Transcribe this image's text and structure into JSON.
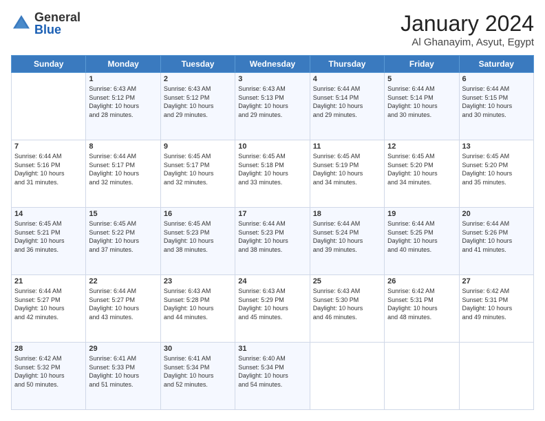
{
  "header": {
    "logo": {
      "general": "General",
      "blue": "Blue"
    },
    "title": "January 2024",
    "subtitle": "Al Ghanayim, Asyut, Egypt"
  },
  "weekdays": [
    "Sunday",
    "Monday",
    "Tuesday",
    "Wednesday",
    "Thursday",
    "Friday",
    "Saturday"
  ],
  "weeks": [
    [
      {
        "day": "",
        "info": ""
      },
      {
        "day": "1",
        "info": "Sunrise: 6:43 AM\nSunset: 5:12 PM\nDaylight: 10 hours\nand 28 minutes."
      },
      {
        "day": "2",
        "info": "Sunrise: 6:43 AM\nSunset: 5:12 PM\nDaylight: 10 hours\nand 29 minutes."
      },
      {
        "day": "3",
        "info": "Sunrise: 6:43 AM\nSunset: 5:13 PM\nDaylight: 10 hours\nand 29 minutes."
      },
      {
        "day": "4",
        "info": "Sunrise: 6:44 AM\nSunset: 5:14 PM\nDaylight: 10 hours\nand 29 minutes."
      },
      {
        "day": "5",
        "info": "Sunrise: 6:44 AM\nSunset: 5:14 PM\nDaylight: 10 hours\nand 30 minutes."
      },
      {
        "day": "6",
        "info": "Sunrise: 6:44 AM\nSunset: 5:15 PM\nDaylight: 10 hours\nand 30 minutes."
      }
    ],
    [
      {
        "day": "7",
        "info": "Sunrise: 6:44 AM\nSunset: 5:16 PM\nDaylight: 10 hours\nand 31 minutes."
      },
      {
        "day": "8",
        "info": "Sunrise: 6:44 AM\nSunset: 5:17 PM\nDaylight: 10 hours\nand 32 minutes."
      },
      {
        "day": "9",
        "info": "Sunrise: 6:45 AM\nSunset: 5:17 PM\nDaylight: 10 hours\nand 32 minutes."
      },
      {
        "day": "10",
        "info": "Sunrise: 6:45 AM\nSunset: 5:18 PM\nDaylight: 10 hours\nand 33 minutes."
      },
      {
        "day": "11",
        "info": "Sunrise: 6:45 AM\nSunset: 5:19 PM\nDaylight: 10 hours\nand 34 minutes."
      },
      {
        "day": "12",
        "info": "Sunrise: 6:45 AM\nSunset: 5:20 PM\nDaylight: 10 hours\nand 34 minutes."
      },
      {
        "day": "13",
        "info": "Sunrise: 6:45 AM\nSunset: 5:20 PM\nDaylight: 10 hours\nand 35 minutes."
      }
    ],
    [
      {
        "day": "14",
        "info": "Sunrise: 6:45 AM\nSunset: 5:21 PM\nDaylight: 10 hours\nand 36 minutes."
      },
      {
        "day": "15",
        "info": "Sunrise: 6:45 AM\nSunset: 5:22 PM\nDaylight: 10 hours\nand 37 minutes."
      },
      {
        "day": "16",
        "info": "Sunrise: 6:45 AM\nSunset: 5:23 PM\nDaylight: 10 hours\nand 38 minutes."
      },
      {
        "day": "17",
        "info": "Sunrise: 6:44 AM\nSunset: 5:23 PM\nDaylight: 10 hours\nand 38 minutes."
      },
      {
        "day": "18",
        "info": "Sunrise: 6:44 AM\nSunset: 5:24 PM\nDaylight: 10 hours\nand 39 minutes."
      },
      {
        "day": "19",
        "info": "Sunrise: 6:44 AM\nSunset: 5:25 PM\nDaylight: 10 hours\nand 40 minutes."
      },
      {
        "day": "20",
        "info": "Sunrise: 6:44 AM\nSunset: 5:26 PM\nDaylight: 10 hours\nand 41 minutes."
      }
    ],
    [
      {
        "day": "21",
        "info": "Sunrise: 6:44 AM\nSunset: 5:27 PM\nDaylight: 10 hours\nand 42 minutes."
      },
      {
        "day": "22",
        "info": "Sunrise: 6:44 AM\nSunset: 5:27 PM\nDaylight: 10 hours\nand 43 minutes."
      },
      {
        "day": "23",
        "info": "Sunrise: 6:43 AM\nSunset: 5:28 PM\nDaylight: 10 hours\nand 44 minutes."
      },
      {
        "day": "24",
        "info": "Sunrise: 6:43 AM\nSunset: 5:29 PM\nDaylight: 10 hours\nand 45 minutes."
      },
      {
        "day": "25",
        "info": "Sunrise: 6:43 AM\nSunset: 5:30 PM\nDaylight: 10 hours\nand 46 minutes."
      },
      {
        "day": "26",
        "info": "Sunrise: 6:42 AM\nSunset: 5:31 PM\nDaylight: 10 hours\nand 48 minutes."
      },
      {
        "day": "27",
        "info": "Sunrise: 6:42 AM\nSunset: 5:31 PM\nDaylight: 10 hours\nand 49 minutes."
      }
    ],
    [
      {
        "day": "28",
        "info": "Sunrise: 6:42 AM\nSunset: 5:32 PM\nDaylight: 10 hours\nand 50 minutes."
      },
      {
        "day": "29",
        "info": "Sunrise: 6:41 AM\nSunset: 5:33 PM\nDaylight: 10 hours\nand 51 minutes."
      },
      {
        "day": "30",
        "info": "Sunrise: 6:41 AM\nSunset: 5:34 PM\nDaylight: 10 hours\nand 52 minutes."
      },
      {
        "day": "31",
        "info": "Sunrise: 6:40 AM\nSunset: 5:34 PM\nDaylight: 10 hours\nand 54 minutes."
      },
      {
        "day": "",
        "info": ""
      },
      {
        "day": "",
        "info": ""
      },
      {
        "day": "",
        "info": ""
      }
    ]
  ]
}
